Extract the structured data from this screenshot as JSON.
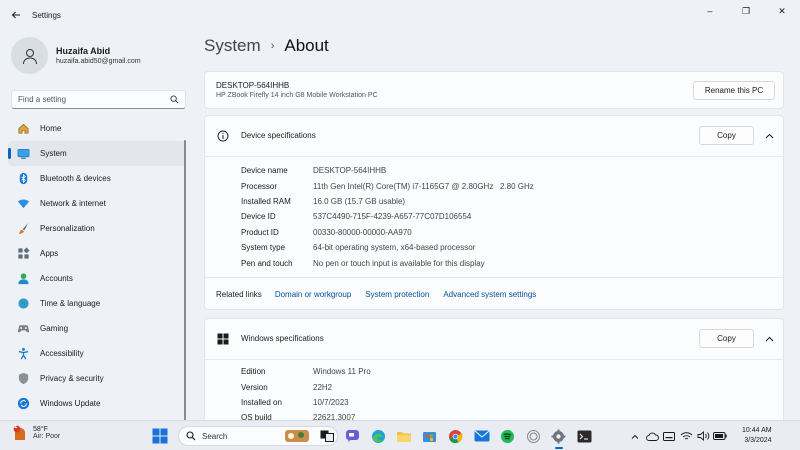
{
  "window": {
    "title": "Settings",
    "minimize_glyph": "–",
    "maximize_glyph": "❐",
    "close_glyph": "✕"
  },
  "profile": {
    "name": "Huzaifa Abid",
    "email": "huzaifa.abid50@gmail.com"
  },
  "search": {
    "placeholder": "Find a setting"
  },
  "nav": {
    "items": [
      {
        "label": "Home",
        "icon": "home-icon"
      },
      {
        "label": "System",
        "icon": "system-icon",
        "active": true
      },
      {
        "label": "Bluetooth & devices",
        "icon": "bluetooth-icon"
      },
      {
        "label": "Network & internet",
        "icon": "network-icon"
      },
      {
        "label": "Personalization",
        "icon": "brush-icon"
      },
      {
        "label": "Apps",
        "icon": "apps-icon"
      },
      {
        "label": "Accounts",
        "icon": "accounts-icon"
      },
      {
        "label": "Time & language",
        "icon": "globe-icon"
      },
      {
        "label": "Gaming",
        "icon": "gaming-icon"
      },
      {
        "label": "Accessibility",
        "icon": "accessibility-icon"
      },
      {
        "label": "Privacy & security",
        "icon": "shield-icon"
      },
      {
        "label": "Windows Update",
        "icon": "update-icon"
      }
    ]
  },
  "breadcrumb": {
    "parent": "System",
    "separator": "›",
    "current": "About"
  },
  "pc": {
    "name": "DESKTOP-564IHHB",
    "model": "HP ZBook Firefly 14 inch G8 Mobile Workstation PC",
    "rename_label": "Rename this PC"
  },
  "device_specs": {
    "title": "Device specifications",
    "copy_label": "Copy",
    "rows": [
      {
        "key": "Device name",
        "value": "DESKTOP-564IHHB"
      },
      {
        "key": "Processor",
        "value": "11th Gen Intel(R) Core(TM) i7-1165G7 @ 2.80GHz   2.80 GHz"
      },
      {
        "key": "Installed RAM",
        "value": "16.0 GB (15.7 GB usable)"
      },
      {
        "key": "Device ID",
        "value": "537C4490-715F-4239-A657-77C07D106554"
      },
      {
        "key": "Product ID",
        "value": "00330-80000-00000-AA970"
      },
      {
        "key": "System type",
        "value": "64-bit operating system, x64-based processor"
      },
      {
        "key": "Pen and touch",
        "value": "No pen or touch input is available for this display"
      }
    ]
  },
  "related": {
    "label": "Related links",
    "links": [
      "Domain or workgroup",
      "System protection",
      "Advanced system settings"
    ]
  },
  "windows_specs": {
    "title": "Windows specifications",
    "copy_label": "Copy",
    "rows": [
      {
        "key": "Edition",
        "value": "Windows 11 Pro"
      },
      {
        "key": "Version",
        "value": "22H2"
      },
      {
        "key": "Installed on",
        "value": "10/7/2023"
      },
      {
        "key": "OS build",
        "value": "22621.3007"
      }
    ]
  },
  "taskbar": {
    "weather": {
      "temp": "58°F",
      "condition": "Air: Poor",
      "badge": "1"
    },
    "search_label": "Search",
    "clock": {
      "time": "10:44 AM",
      "date": "3/3/2024"
    }
  },
  "colors": {
    "accent": "#0067c0",
    "link": "#004f9e",
    "background": "#eef1f6",
    "card": "#fbfcfd"
  }
}
